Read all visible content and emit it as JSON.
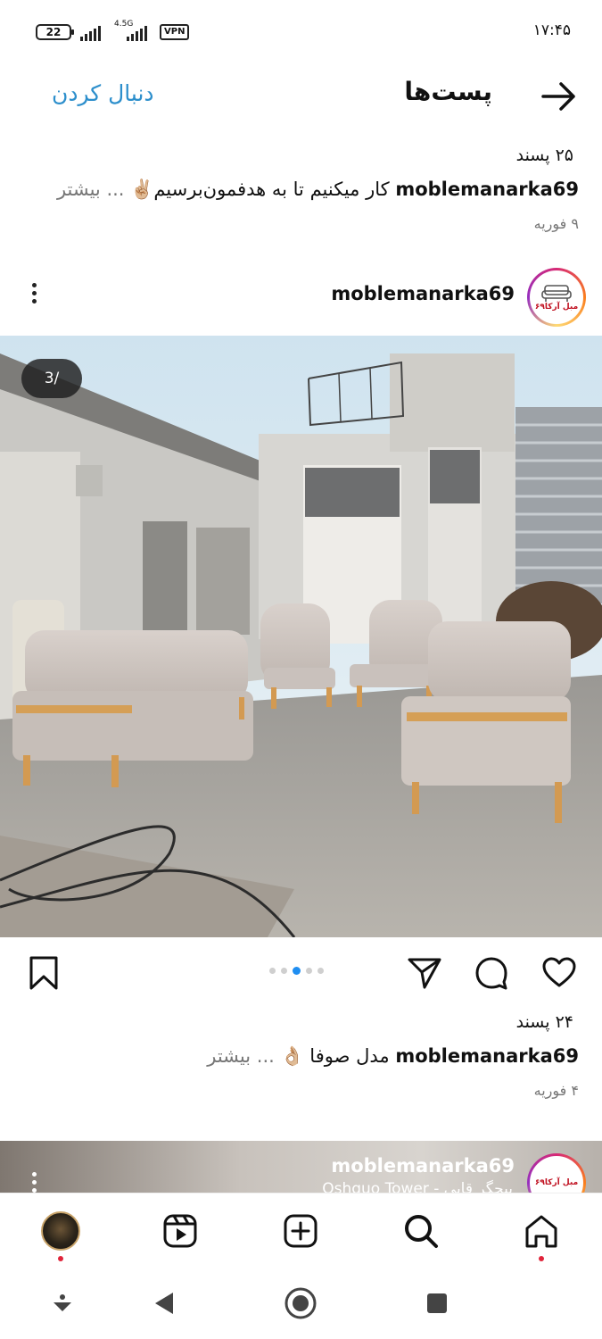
{
  "status_bar": {
    "battery": "22",
    "network": "4.5G",
    "vpn": "VPN",
    "time": "۱۷:۴۵"
  },
  "header": {
    "title": "پست‌ها",
    "follow_label": "دنبال کردن",
    "back_icon": "arrow-right-icon"
  },
  "previous_post": {
    "likes": "۲۵ پسند",
    "username": "moblemanarka69",
    "caption": " کار میکنیم تا به هدفمون‌برسیم✌🏼",
    "more": "... بیشتر",
    "date": "۹ فوریه"
  },
  "post": {
    "username": "moblemanarka69",
    "avatar_text": "مبل آرکا۶۹",
    "counter": "3/",
    "carousel": {
      "count": 5,
      "active_index": 2
    },
    "likes": "۲۴ پسند",
    "caption": " مدل صوفا 👌🏼",
    "more": "... بیشتر",
    "date": "۴ فوریه"
  },
  "next_post": {
    "username": "moblemanarka69",
    "location": "Oshquo Tower - بیجگر قایی"
  },
  "bottom_nav": {
    "items": [
      "profile",
      "reels",
      "create",
      "search",
      "home"
    ]
  },
  "colors": {
    "link_blue": "#2d8fcc",
    "active_dot": "#1f8ef1",
    "notify_red": "#e0243a"
  }
}
